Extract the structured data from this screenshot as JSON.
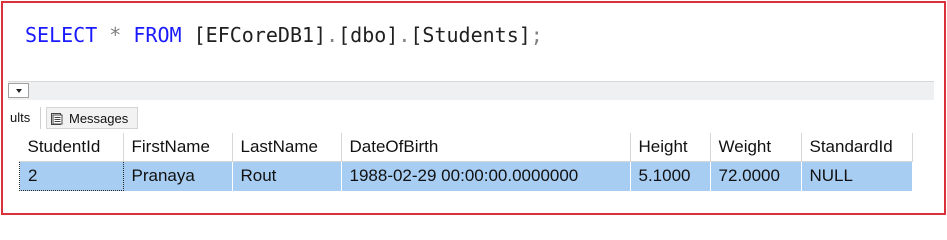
{
  "editor": {
    "kw_select": "SELECT",
    "star": "*",
    "kw_from": "FROM",
    "db": "[EFCoreDB1]",
    "dot1": ".",
    "schema": "[dbo]",
    "dot2": ".",
    "table": "[Students]",
    "semicolon": ";"
  },
  "tabs": {
    "results": "ults",
    "messages": "Messages"
  },
  "grid": {
    "columns": [
      "StudentId",
      "FirstName",
      "LastName",
      "DateOfBirth",
      "Height",
      "Weight",
      "StandardId"
    ],
    "rows": [
      [
        "2",
        "Pranaya",
        "Rout",
        "1988-02-29 00:00:00.0000000",
        "5.1000",
        "72.0000",
        "NULL"
      ]
    ]
  },
  "colors": {
    "keyword": "#1a1aff",
    "frame_border": "#d9303a",
    "selected_row": "#a8cdf2"
  }
}
